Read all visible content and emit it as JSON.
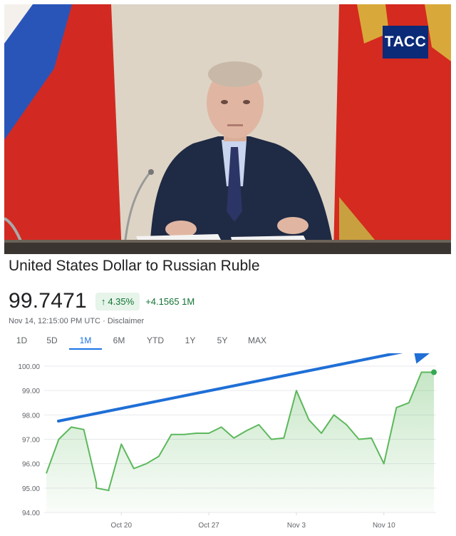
{
  "photo": {
    "logo_text": "ТАСС"
  },
  "quote": {
    "title": "United States Dollar to Russian Ruble",
    "price": "99.7471",
    "change_percent": "4.35%",
    "change_absolute": "+4.1565 1M",
    "timestamp": "Nov 14, 12:15:00 PM UTC",
    "separator": "·",
    "disclaimer": "Disclaimer",
    "ranges": [
      {
        "label": "1D",
        "active": false
      },
      {
        "label": "5D",
        "active": false
      },
      {
        "label": "1M",
        "active": true
      },
      {
        "label": "6M",
        "active": false
      },
      {
        "label": "YTD",
        "active": false
      },
      {
        "label": "1Y",
        "active": false
      },
      {
        "label": "5Y",
        "active": false
      },
      {
        "label": "MAX",
        "active": false
      }
    ],
    "colors": {
      "positive": "#137333",
      "line": "#5cb85c",
      "accent": "#1a73e8",
      "trend_arrow": "#1f6fd6"
    }
  },
  "chart_data": {
    "type": "area",
    "title": "",
    "xlabel": "",
    "ylabel": "",
    "ylim": [
      94.0,
      100.0
    ],
    "y_ticks": [
      "94.00",
      "95.00",
      "96.00",
      "97.00",
      "98.00",
      "99.00",
      "100.00"
    ],
    "x_ticks": [
      {
        "label": "Oct 20",
        "date": "2023-10-20"
      },
      {
        "label": "Oct 27",
        "date": "2023-10-27"
      },
      {
        "label": "Nov 3",
        "date": "2023-11-03"
      },
      {
        "label": "Nov 10",
        "date": "2023-11-10"
      }
    ],
    "x_range": [
      "2023-10-14",
      "2023-11-14"
    ],
    "grid": true,
    "series": [
      {
        "x": [
          "2023-10-14",
          "2023-10-15",
          "2023-10-16",
          "2023-10-17",
          "2023-10-18",
          "2023-10-18",
          "2023-10-19",
          "2023-10-19",
          "2023-10-20",
          "2023-10-21",
          "2023-10-22",
          "2023-10-23",
          "2023-10-24",
          "2023-10-25",
          "2023-10-26",
          "2023-10-27",
          "2023-10-28",
          "2023-10-29",
          "2023-10-30",
          "2023-10-31",
          "2023-11-01",
          "2023-11-02",
          "2023-11-03",
          "2023-11-04",
          "2023-11-05",
          "2023-11-06",
          "2023-11-07",
          "2023-11-08",
          "2023-11-09",
          "2023-11-10",
          "2023-11-11",
          "2023-11-12",
          "2023-11-13",
          "2023-11-14"
        ],
        "y": [
          95.6,
          97.0,
          97.5,
          97.4,
          95.2,
          95.0,
          94.9,
          94.95,
          96.8,
          95.8,
          96.0,
          96.3,
          97.2,
          97.2,
          97.25,
          97.25,
          97.5,
          97.05,
          97.35,
          97.6,
          97.0,
          97.05,
          99.0,
          97.8,
          97.25,
          98.0,
          97.6,
          97.0,
          97.05,
          96.0,
          98.3,
          98.5,
          99.75,
          99.75
        ]
      }
    ],
    "annotations": [
      "trend arrow pointing up-right"
    ]
  }
}
